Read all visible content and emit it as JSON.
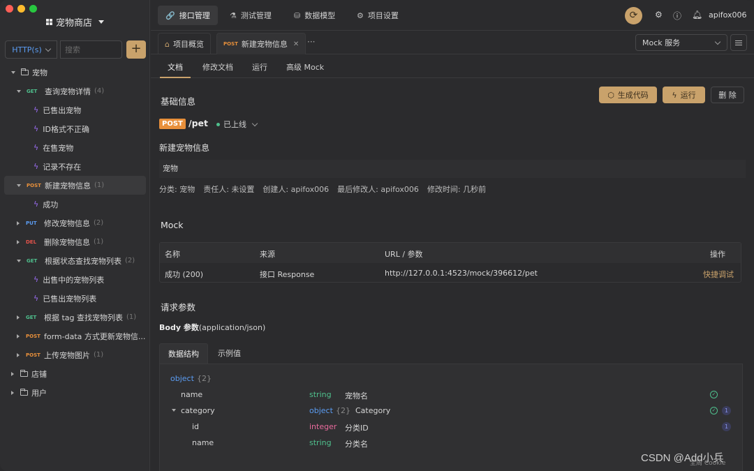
{
  "sidebar": {
    "project_title": "宠物商店",
    "protocol": "HTTP(s)",
    "search_placeholder": "搜索",
    "add_label": "+",
    "tree": [
      {
        "type": "folder",
        "label": "宠物",
        "level": 0,
        "expanded": true
      },
      {
        "type": "api",
        "method": "GET",
        "label": "查询宠物详情",
        "count": "(4)",
        "level": 1,
        "expanded": true
      },
      {
        "type": "case",
        "label": "已售出宠物",
        "level": 2
      },
      {
        "type": "case",
        "label": "ID格式不正确",
        "level": 2
      },
      {
        "type": "case",
        "label": "在售宠物",
        "level": 2
      },
      {
        "type": "case",
        "label": "记录不存在",
        "level": 2
      },
      {
        "type": "api",
        "method": "POST",
        "label": "新建宠物信息",
        "count": "(1)",
        "level": 1,
        "expanded": true,
        "selected": true
      },
      {
        "type": "case",
        "label": "成功",
        "level": 2
      },
      {
        "type": "api",
        "method": "PUT",
        "label": "修改宠物信息",
        "count": "(2)",
        "level": 1,
        "expanded": false
      },
      {
        "type": "api",
        "method": "DEL",
        "label": "删除宠物信息",
        "count": "(1)",
        "level": 1,
        "expanded": false
      },
      {
        "type": "api",
        "method": "GET",
        "label": "根据状态查找宠物列表",
        "count": "(2)",
        "level": 1,
        "expanded": true
      },
      {
        "type": "case",
        "label": "出售中的宠物列表",
        "level": 2
      },
      {
        "type": "case",
        "label": "已售出宠物列表",
        "level": 2
      },
      {
        "type": "api",
        "method": "GET",
        "label": "根据 tag 查找宠物列表",
        "count": "(1)",
        "level": 1,
        "expanded": false
      },
      {
        "type": "api",
        "method": "POST",
        "label": "form-data 方式更新宠物信...",
        "count": "",
        "level": 1,
        "expanded": false
      },
      {
        "type": "api",
        "method": "POST",
        "label": "上传宠物图片",
        "count": "(1)",
        "level": 1,
        "expanded": false
      },
      {
        "type": "folder",
        "label": "店铺",
        "level": 0,
        "expanded": false
      },
      {
        "type": "folder",
        "label": "用户",
        "level": 0,
        "expanded": false
      }
    ]
  },
  "topbar": {
    "tabs": [
      {
        "label": "接口管理",
        "icon": "link-icon",
        "glyph": "🔗",
        "active": true
      },
      {
        "label": "测试管理",
        "icon": "flask-icon",
        "glyph": "⚗",
        "active": false
      },
      {
        "label": "数据模型",
        "icon": "model-icon",
        "glyph": "⛁",
        "active": false
      },
      {
        "label": "项目设置",
        "icon": "gear-icon",
        "glyph": "⚙",
        "active": false
      }
    ],
    "username": "apifox006"
  },
  "tabbar": {
    "overview_label": "项目概览",
    "active_method": "POST",
    "active_label": "新建宠物信息",
    "more": "···",
    "mock_service": "Mock 服务"
  },
  "subtabs": [
    "文档",
    "修改文档",
    "运行",
    "高级 Mock"
  ],
  "doc": {
    "basic_title": "基础信息",
    "btn_generate": "生成代码",
    "btn_run": "运行",
    "btn_delete": "删 除",
    "method": "POST",
    "path": "/pet",
    "status": "已上线",
    "api_name": "新建宠物信息",
    "tag": "宠物",
    "meta": [
      "分类: 宠物",
      "责任人: 未设置",
      "创建人: apifox006",
      "最后修改人: apifox006",
      "修改时间: 几秒前"
    ],
    "mock_title": "Mock",
    "mock_table": {
      "headers": [
        "名称",
        "来源",
        "URL / 参数",
        "操作"
      ],
      "rows": [
        [
          "成功 (200)",
          "接口 Response",
          "http://127.0.0.1:4523/mock/396612/pet",
          "快捷调试"
        ]
      ]
    },
    "params_title": "请求参数",
    "body_label_bold": "Body 参数",
    "body_label_rest": "(application/json)",
    "inner_tabs": [
      "数据结构",
      "示例值"
    ],
    "schema": [
      {
        "name": "object",
        "count": "{2}",
        "type": "",
        "desc": "",
        "indent": 0,
        "root": true
      },
      {
        "name": "name",
        "type": "string",
        "count": "",
        "desc": "宠物名",
        "indent": 1,
        "required": true,
        "badge": ""
      },
      {
        "name": "category",
        "type": "object",
        "count": "{2}",
        "desc": "Category",
        "indent": 1,
        "required": true,
        "badge": "1",
        "expanded": true
      },
      {
        "name": "id",
        "type": "integer",
        "count": "",
        "desc": "分类ID",
        "indent": 2,
        "required": false,
        "badge": "1"
      },
      {
        "name": "name",
        "type": "string",
        "count": "",
        "desc": "分类名",
        "indent": 2,
        "required": false,
        "badge": ""
      }
    ]
  },
  "watermark": "CSDN @Add小兵",
  "watermark2": "全周 Cookie",
  "colors": {
    "accent": "#c9a26b",
    "get": "#4fc08d",
    "post": "#e8903b",
    "put": "#5b9cf2",
    "del": "#e5534b"
  }
}
